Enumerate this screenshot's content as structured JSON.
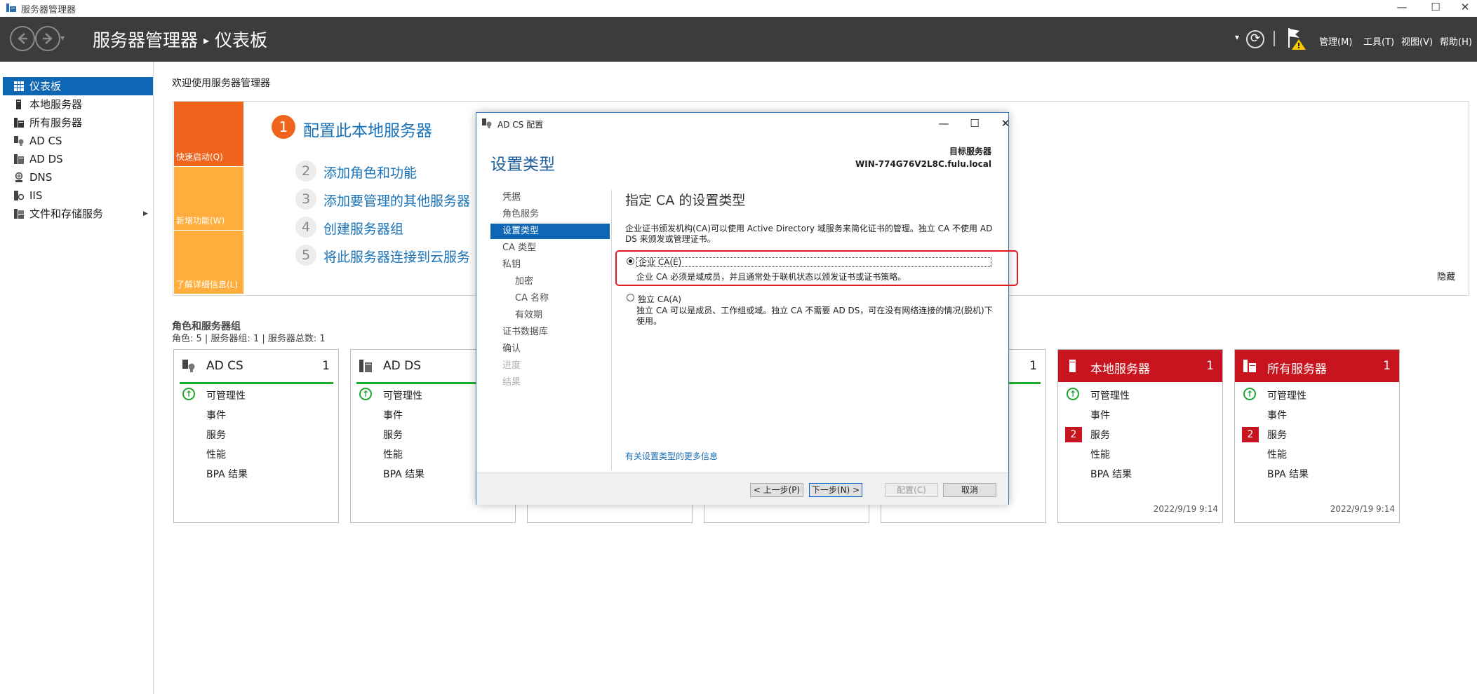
{
  "window": {
    "title": "服务器管理器",
    "controls": [
      "—",
      "☐",
      "✕"
    ]
  },
  "header": {
    "app_name": "服务器管理器",
    "separator": "▸",
    "page": "仪表板",
    "dropdown_glyph": "▾",
    "refresh_glyph": "⟳",
    "menus": [
      "管理(M)",
      "工具(T)",
      "视图(V)",
      "帮助(H)"
    ]
  },
  "sidebar": {
    "items": [
      {
        "label": "仪表板",
        "icon": "dashboard-icon",
        "active": true
      },
      {
        "label": "本地服务器",
        "icon": "server-icon"
      },
      {
        "label": "所有服务器",
        "icon": "servers-icon"
      },
      {
        "label": "AD CS",
        "icon": "adcs-icon"
      },
      {
        "label": "AD DS",
        "icon": "adds-icon"
      },
      {
        "label": "DNS",
        "icon": "dns-icon"
      },
      {
        "label": "IIS",
        "icon": "iis-icon"
      },
      {
        "label": "文件和存储服务",
        "icon": "storage-icon",
        "expandable": true
      }
    ],
    "expand_glyph": "▶"
  },
  "main": {
    "welcome": "欢迎使用服务器管理器",
    "tiles": [
      "快速启动(Q)",
      "新增功能(W)",
      "了解详细信息(L)"
    ],
    "steps": [
      {
        "num": "1",
        "label": "配置此本地服务器"
      },
      {
        "num": "2",
        "label": "添加角色和功能"
      },
      {
        "num": "3",
        "label": "添加要管理的其他服务器"
      },
      {
        "num": "4",
        "label": "创建服务器组"
      },
      {
        "num": "5",
        "label": "将此服务器连接到云服务"
      }
    ],
    "hide": "隐藏",
    "roles_title": "角色和服务器组",
    "roles_sub": "角色: 5 | 服务器组: 1 | 服务器总数: 1"
  },
  "cards": [
    {
      "name": "AD CS",
      "count": "1",
      "rows": [
        "可管理性",
        "事件",
        "服务",
        "性能",
        "BPA 结果"
      ]
    },
    {
      "name": "AD DS",
      "count": "1",
      "rows": [
        "可管理性",
        "事件",
        "服务",
        "性能",
        "BPA 结果"
      ]
    },
    {
      "name": "",
      "count": ""
    },
    {
      "name": "",
      "count": ""
    },
    {
      "name": "",
      "count": "1"
    },
    {
      "name": "本地服务器",
      "count": "1",
      "rows": [
        "可管理性",
        "事件",
        "服务",
        "性能",
        "BPA 结果"
      ],
      "badge": "2",
      "timestamp": "2022/9/19 9:14"
    },
    {
      "name": "所有服务器",
      "count": "1",
      "rows": [
        "可管理性",
        "事件",
        "服务",
        "性能",
        "BPA 结果"
      ],
      "badge": "2",
      "timestamp": "2022/9/19 9:14"
    }
  ],
  "dialog": {
    "title": "AD CS 配置",
    "heading": "设置类型",
    "target_label": "目标服务器",
    "target_value": "WIN-774G76V2L8C.fulu.local",
    "nav": [
      {
        "label": "凭据"
      },
      {
        "label": "角色服务"
      },
      {
        "label": "设置类型",
        "active": true
      },
      {
        "label": "CA 类型"
      },
      {
        "label": "私钥"
      },
      {
        "label": "加密",
        "indent": true
      },
      {
        "label": "CA 名称",
        "indent": true
      },
      {
        "label": "有效期",
        "indent": true
      },
      {
        "label": "证书数据库"
      },
      {
        "label": "确认"
      },
      {
        "label": "进度",
        "dim": true
      },
      {
        "label": "结果",
        "dim": true
      }
    ],
    "section_title": "指定 CA 的设置类型",
    "description": "企业证书颁发机构(CA)可以使用 Active Directory 域服务来简化证书的管理。独立 CA 不使用 AD DS 来颁发或管理证书。",
    "options": [
      {
        "label": "企业 CA(E)",
        "desc": "企业 CA 必须是域成员，并且通常处于联机状态以颁发证书或证书策略。",
        "selected": true
      },
      {
        "label": "独立 CA(A)",
        "desc": "独立 CA 可以是成员、工作组或域。独立 CA 不需要 AD DS，可在没有网络连接的情况(脱机)下使用。",
        "selected": false
      }
    ],
    "more_info": "有关设置类型的更多信息",
    "buttons": {
      "prev": "< 上一步(P)",
      "next": "下一步(N) >",
      "configure": "配置(C)",
      "cancel": "取消"
    }
  },
  "colors": {
    "accent": "#0d67b4",
    "header_bg": "#3c3c3c",
    "orange": "#f0641e",
    "amber": "#ffad3c",
    "ok_green": "#1db02d",
    "alert_red": "#c8141e",
    "highlight": "#e01b24"
  }
}
